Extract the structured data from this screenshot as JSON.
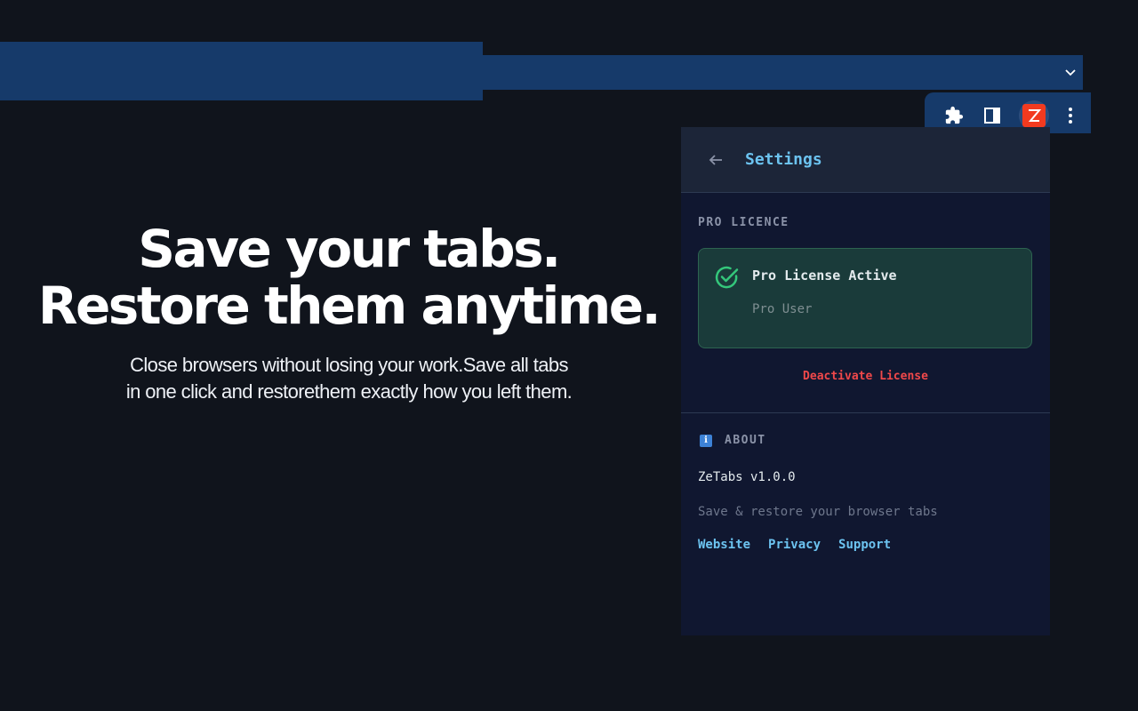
{
  "hero": {
    "title_line1": "Save your tabs.",
    "title_line2": "Restore them anytime.",
    "subtitle_line1": "Close browsers without losing your work.Save all tabs",
    "subtitle_line2": "in one click and restorethem exactly how you left them."
  },
  "browser": {
    "toolbar_icons": [
      "puzzle-icon",
      "sidepanel-icon",
      "zetabs-extension-icon",
      "more-vert-icon"
    ],
    "tab_search_icon": "chevron-down-icon"
  },
  "popup": {
    "header": {
      "back_icon": "arrow-left-icon",
      "title": "Settings"
    },
    "licence": {
      "section_label": "PRO LICENCE",
      "status": "Pro License Active",
      "user": "Pro User",
      "deactivate_label": "Deactivate License"
    },
    "about": {
      "icon_glyph": "i",
      "section_label": "ABOUT",
      "version": "ZeTabs v1.0.0",
      "tagline": "Save & restore your browser tabs",
      "links": [
        "Website",
        "Privacy",
        "Support"
      ]
    }
  },
  "colors": {
    "background": "#10141c",
    "chrome": "#163a6a",
    "accent": "#6cc3f0",
    "success": "#34c77b",
    "danger": "#f0484a",
    "brand": "#f23a1f"
  }
}
